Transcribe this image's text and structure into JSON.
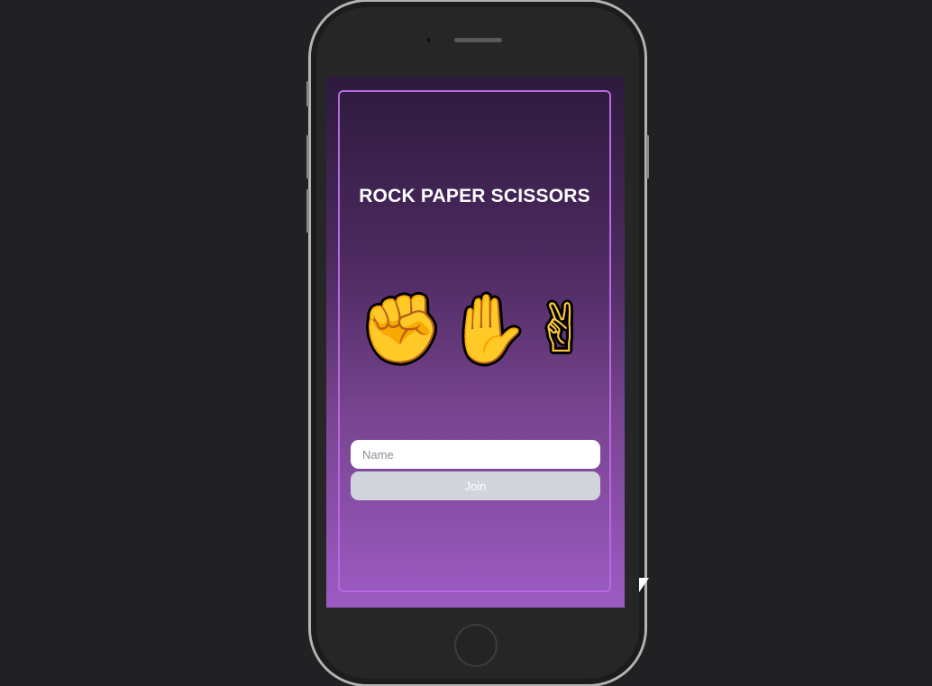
{
  "game": {
    "title": "ROCK PAPER SCISSORS",
    "hands": [
      {
        "icon": "raised-fist-icon",
        "glyph": "✊"
      },
      {
        "icon": "raised-hand-icon",
        "glyph": "✋"
      },
      {
        "icon": "victory-hand-icon",
        "glyph": "✌"
      }
    ],
    "name_placeholder": "Name",
    "name_value": "",
    "join_label": "Join"
  },
  "colors": {
    "accent_border": "#b868e0",
    "join_button": "#d1d5db",
    "emoji_fill": "#ffc83d"
  }
}
